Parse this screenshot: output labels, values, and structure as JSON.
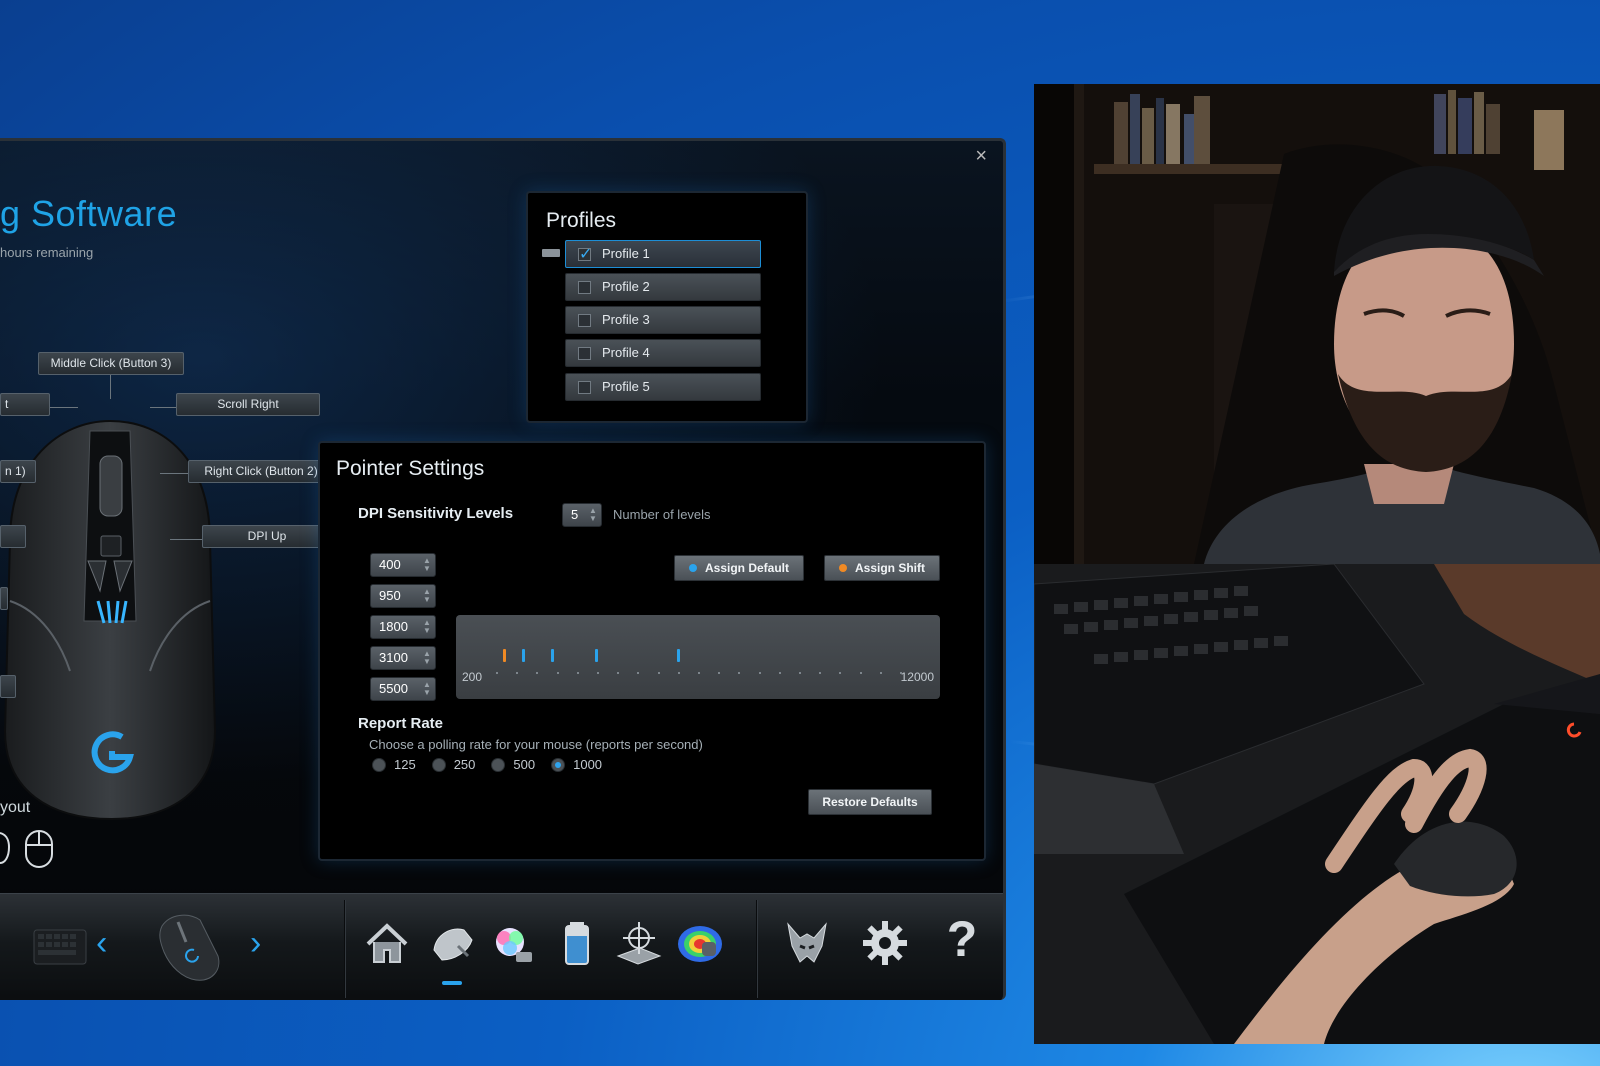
{
  "window": {
    "title": "g Software",
    "subtitle": "hours remaining",
    "close_glyph": "×"
  },
  "button_callouts": [
    {
      "label": "Middle Click (Button 3)"
    },
    {
      "label": "Scroll Right"
    },
    {
      "label": "t"
    },
    {
      "label": "n 1)"
    },
    {
      "label": "Right Click (Button 2)"
    },
    {
      "label": "DPI Up"
    }
  ],
  "layout_section": {
    "label": "yout"
  },
  "profiles": {
    "title": "Profiles",
    "items": [
      {
        "label": "Profile 1",
        "checked": true
      },
      {
        "label": "Profile 2",
        "checked": false
      },
      {
        "label": "Profile 3",
        "checked": false
      },
      {
        "label": "Profile 4",
        "checked": false
      },
      {
        "label": "Profile 5",
        "checked": false
      }
    ]
  },
  "pointer_settings": {
    "title": "Pointer Settings",
    "dpi_title": "DPI Sensitivity Levels",
    "levels_count": "5",
    "levels_label": "Number of levels",
    "dpi_levels": [
      "400",
      "950",
      "1800",
      "3100",
      "5500"
    ],
    "assign_default_label": "Assign Default",
    "assign_shift_label": "Assign Shift",
    "slider_min": "200",
    "slider_max": "12000",
    "slider_marks": [
      {
        "dpi": 400,
        "color": "#f08a24"
      },
      {
        "dpi": 950,
        "color": "#2aa3ec"
      },
      {
        "dpi": 1800,
        "color": "#2aa3ec"
      },
      {
        "dpi": 3100,
        "color": "#2aa3ec"
      },
      {
        "dpi": 5500,
        "color": "#2aa3ec"
      }
    ],
    "report_rate_title": "Report Rate",
    "report_rate_desc": "Choose a polling rate for your mouse (reports per second)",
    "report_rates": [
      {
        "label": "125",
        "selected": false
      },
      {
        "label": "250",
        "selected": false
      },
      {
        "label": "500",
        "selected": false
      },
      {
        "label": "1000",
        "selected": true
      }
    ],
    "restore_defaults_label": "Restore Defaults"
  },
  "bottom_bar": {
    "icons": [
      "keyboard-device-icon",
      "prev-device-icon",
      "mouse-device-icon",
      "next-device-icon",
      "home-icon",
      "pointer-settings-icon",
      "lighting-icon",
      "battery-icon",
      "surface-tuning-icon",
      "heatmap-icon",
      "arx-control-icon",
      "settings-gear-icon",
      "help-icon"
    ],
    "prev_glyph": "‹",
    "next_glyph": "›",
    "help_glyph": "?"
  },
  "colors": {
    "accent": "#2aa3ec",
    "shift_accent": "#f08a24",
    "desktop_blue": "#0b5fc4"
  }
}
